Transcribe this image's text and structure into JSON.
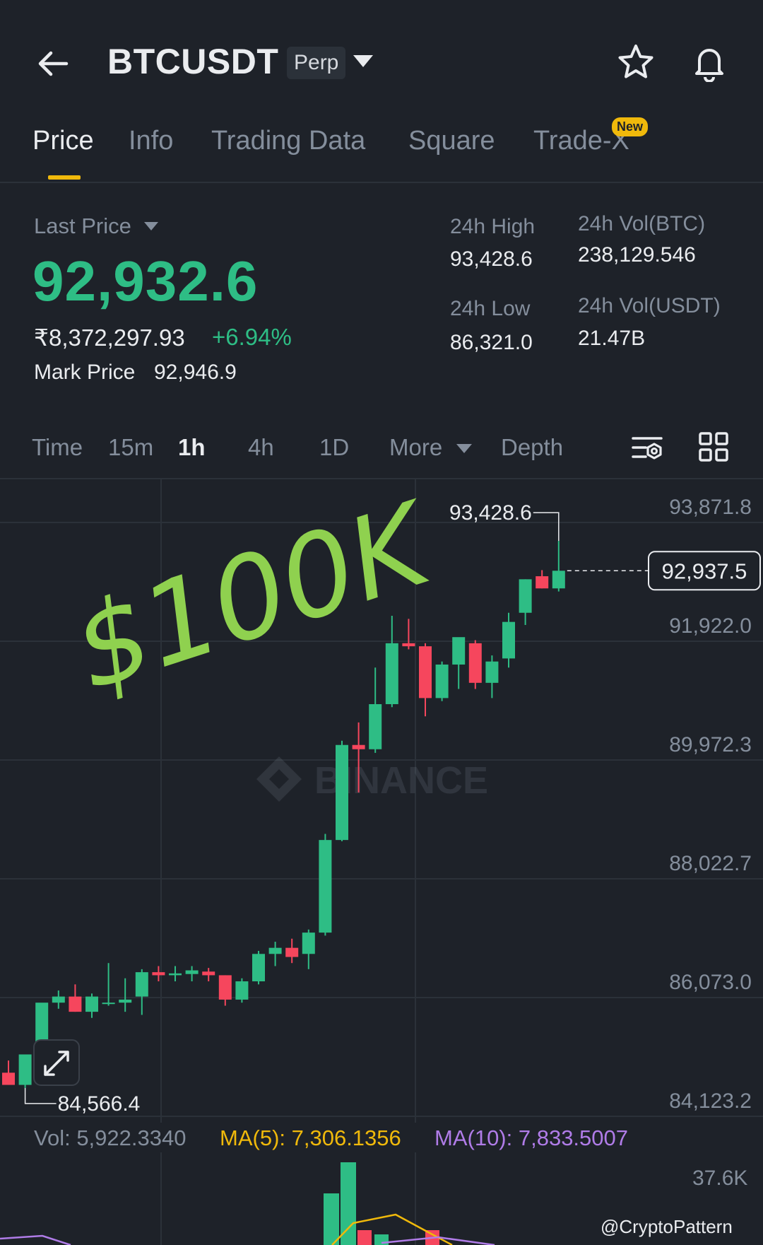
{
  "header": {
    "symbol": "BTCUSDT",
    "contract_type": "Perp"
  },
  "tabs": [
    {
      "label": "Price"
    },
    {
      "label": "Info"
    },
    {
      "label": "Trading Data"
    },
    {
      "label": "Square"
    },
    {
      "label": "Trade-X"
    }
  ],
  "new_badge": "New",
  "price": {
    "last_price_label": "Last Price",
    "last_price": "92,932.6",
    "inr_price": "₹8,372,297.93",
    "change_pct": "+6.94%",
    "mark_price_label": "Mark Price",
    "mark_price": "92,946.9"
  },
  "stats": {
    "high_label": "24h High",
    "high_value": "93,428.6",
    "low_label": "24h Low",
    "low_value": "86,321.0",
    "vol_btc_label": "24h Vol(BTC)",
    "vol_btc_value": "238,129.546",
    "vol_usdt_label": "24h Vol(USDT)",
    "vol_usdt_value": "21.47B"
  },
  "intervals": [
    "Time",
    "15m",
    "1h",
    "4h",
    "1D",
    "More",
    "Depth"
  ],
  "active_interval": "1h",
  "volume_row": {
    "vol": "Vol: 5,922.3340",
    "ma5": "MA(5): 7,306.1356",
    "ma10": "MA(10): 7,833.5007",
    "vol_axis_label": "37.6K"
  },
  "overlay_text": "$100K",
  "watermark": "BINANCE",
  "handle": "@CryptoPattern",
  "colors": {
    "background": "#1e2229",
    "up": "#2ebd85",
    "down": "#f6465d",
    "accent": "#f0b90b",
    "ma5": "#f0b90b",
    "ma10": "#b07ce8",
    "handwriting": "#8fd14f"
  },
  "icons": [
    "back-arrow-icon",
    "caret-down-icon",
    "star-icon",
    "bell-icon",
    "chart-settings-icon",
    "layout-grid-icon",
    "expand-icon",
    "binance-logo-icon"
  ],
  "chart_data": {
    "type": "candlestick",
    "interval": "1h",
    "y_tick_labels": [
      "93,871.8",
      "91,922.0",
      "89,972.3",
      "88,022.7",
      "86,073.0",
      "84,123.2"
    ],
    "ylim": [
      84123.2,
      93871.8
    ],
    "grid": true,
    "high_marker": "93,428.6",
    "low_marker": "84,566.4",
    "current_price_tag": "92,937.5",
    "candles": [
      {
        "o": 84700,
        "h": 84900,
        "l": 84500,
        "c": 84500
      },
      {
        "o": 84500,
        "h": 84950,
        "l": 84450,
        "c": 85000
      },
      {
        "o": 84950,
        "h": 85650,
        "l": 84850,
        "c": 85850
      },
      {
        "o": 85850,
        "h": 86050,
        "l": 85750,
        "c": 85950
      },
      {
        "o": 85950,
        "h": 86150,
        "l": 85700,
        "c": 85700
      },
      {
        "o": 85700,
        "h": 86000,
        "l": 85600,
        "c": 85950
      },
      {
        "o": 85850,
        "h": 86500,
        "l": 85800,
        "c": 85850
      },
      {
        "o": 85850,
        "h": 86250,
        "l": 85700,
        "c": 85900
      },
      {
        "o": 85950,
        "h": 86400,
        "l": 85650,
        "c": 86350
      },
      {
        "o": 86350,
        "h": 86450,
        "l": 86200,
        "c": 86300
      },
      {
        "o": 86300,
        "h": 86450,
        "l": 86200,
        "c": 86330
      },
      {
        "o": 86320,
        "h": 86450,
        "l": 86200,
        "c": 86380
      },
      {
        "o": 86360,
        "h": 86420,
        "l": 86200,
        "c": 86300
      },
      {
        "o": 86300,
        "h": 86300,
        "l": 85800,
        "c": 85900
      },
      {
        "o": 85900,
        "h": 86250,
        "l": 85850,
        "c": 86200
      },
      {
        "o": 86200,
        "h": 86700,
        "l": 86150,
        "c": 86650
      },
      {
        "o": 86650,
        "h": 86850,
        "l": 86450,
        "c": 86750
      },
      {
        "o": 86750,
        "h": 86900,
        "l": 86500,
        "c": 86600
      },
      {
        "o": 86650,
        "h": 87050,
        "l": 86400,
        "c": 87000
      },
      {
        "o": 87000,
        "h": 88620,
        "l": 86950,
        "c": 88520
      },
      {
        "o": 88520,
        "h": 90150,
        "l": 88500,
        "c": 90080
      },
      {
        "o": 90080,
        "h": 90450,
        "l": 89300,
        "c": 90010
      },
      {
        "o": 90010,
        "h": 91350,
        "l": 89950,
        "c": 90750
      },
      {
        "o": 90750,
        "h": 92200,
        "l": 90700,
        "c": 91750
      },
      {
        "o": 91750,
        "h": 92150,
        "l": 91650,
        "c": 91700
      },
      {
        "o": 91700,
        "h": 91750,
        "l": 90550,
        "c": 90850
      },
      {
        "o": 90850,
        "h": 91450,
        "l": 90800,
        "c": 91400
      },
      {
        "o": 91400,
        "h": 91800,
        "l": 91000,
        "c": 91850
      },
      {
        "o": 91750,
        "h": 91800,
        "l": 91000,
        "c": 91100
      },
      {
        "o": 91100,
        "h": 91550,
        "l": 90850,
        "c": 91450
      },
      {
        "o": 91500,
        "h": 92250,
        "l": 91350,
        "c": 92100
      },
      {
        "o": 92250,
        "h": 92800,
        "l": 92050,
        "c": 92800
      },
      {
        "o": 92850,
        "h": 92950,
        "l": 92650,
        "c": 92650
      },
      {
        "o": 92650,
        "h": 93430,
        "l": 92600,
        "c": 92940
      }
    ]
  }
}
